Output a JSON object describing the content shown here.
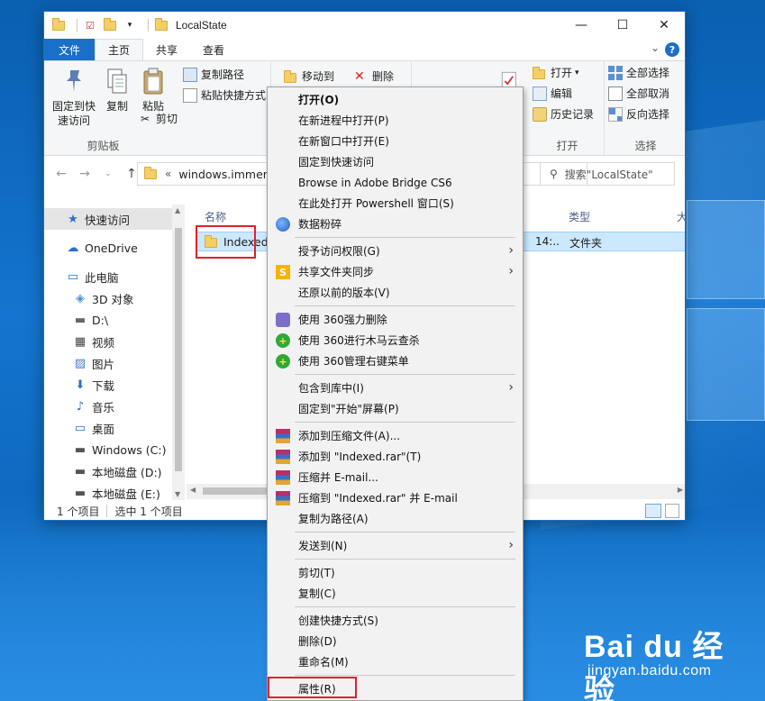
{
  "window": {
    "title": "LocalState"
  },
  "win_controls": {
    "minimize": "—",
    "maximize": "☐",
    "close": "✕"
  },
  "ribbon_tabs": {
    "file": "文件",
    "home": "主页",
    "share": "共享",
    "view": "查看",
    "help": "?"
  },
  "ribbon": {
    "clipboard": {
      "pin_quick_access": "固定到快速访问",
      "copy": "复制",
      "paste": "粘贴",
      "copy_path": "复制路径",
      "paste_shortcut": "粘贴快捷方式",
      "cut": "剪切",
      "group_label": "剪贴板"
    },
    "organize": {
      "move_to": "移动到",
      "delete": "删除"
    },
    "open": {
      "open": "打开",
      "edit": "编辑",
      "history": "历史记录",
      "group_label": "打开"
    },
    "select": {
      "select_all": "全部选择",
      "select_none": "全部取消",
      "invert": "反向选择",
      "group_label": "选择"
    }
  },
  "address": {
    "crumb": "windows.immersi",
    "prefix": "«",
    "search_placeholder": "搜索\"LocalState\""
  },
  "nav": {
    "items": [
      {
        "label": "快速访问",
        "icon": "star-icon"
      },
      {
        "label": "OneDrive",
        "icon": "cloud-icon"
      },
      {
        "label": "此电脑",
        "icon": "computer-icon"
      },
      {
        "label": "3D 对象",
        "icon": "cube-icon"
      },
      {
        "label": "D:\\",
        "icon": "drive-icon"
      },
      {
        "label": "视频",
        "icon": "video-icon"
      },
      {
        "label": "图片",
        "icon": "picture-icon"
      },
      {
        "label": "下载",
        "icon": "download-icon"
      },
      {
        "label": "音乐",
        "icon": "music-icon"
      },
      {
        "label": "桌面",
        "icon": "desktop-icon"
      },
      {
        "label": "Windows (C:)",
        "icon": "windows-drive-icon"
      },
      {
        "label": "本地磁盘 (D:)",
        "icon": "disk-icon"
      },
      {
        "label": "本地磁盘 (E:)",
        "icon": "disk-icon"
      }
    ]
  },
  "files": {
    "columns": {
      "name": "名称",
      "type": "类型",
      "size": "大"
    },
    "row": {
      "name": "Indexed",
      "modified": "14:..",
      "type": "文件夹"
    }
  },
  "status": {
    "count": "1 个项目",
    "selected": "选中 1 个项目"
  },
  "context_menu": {
    "group1": [
      "打开(O)",
      "在新进程中打开(P)",
      "在新窗口中打开(E)",
      "固定到快速访问",
      "Browse in Adobe Bridge CS6",
      "在此处打开 Powershell 窗口(S)",
      "数据粉碎"
    ],
    "group2": [
      "授予访问权限(G)",
      "共享文件夹同步",
      "还原以前的版本(V)"
    ],
    "group3": [
      "使用 360强力删除",
      "使用 360进行木马云查杀",
      "使用 360管理右键菜单"
    ],
    "group4": [
      "包含到库中(I)",
      "固定到\"开始\"屏幕(P)"
    ],
    "group5": [
      "添加到压缩文件(A)...",
      "添加到 \"Indexed.rar\"(T)",
      "压缩并 E-mail...",
      "压缩到 \"Indexed.rar\" 并 E-mail",
      "复制为路径(A)"
    ],
    "group6": [
      "发送到(N)"
    ],
    "group7": [
      "剪切(T)",
      "复制(C)"
    ],
    "group8": [
      "创建快捷方式(S)",
      "删除(D)",
      "重命名(M)"
    ],
    "group9": [
      "属性(R)"
    ]
  },
  "watermark": {
    "logo": "Bai du 经验",
    "url": "jingyan.baidu.com"
  },
  "colors": {
    "accent": "#1a6fc8",
    "highlight_red": "#e0202a",
    "selection": "#cce8ff"
  }
}
